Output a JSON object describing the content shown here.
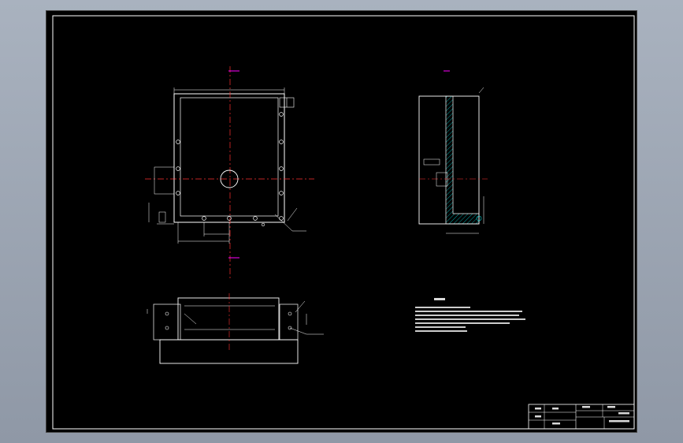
{
  "drawing": {
    "background": "#000000",
    "line_color": "#ffffff",
    "centerline_color": "#ff0000",
    "section_mark_color": "#ff00ff",
    "hatch_color": "#00c8c8"
  },
  "title_block": {
    "cell_a": "",
    "cell_b": "",
    "cell_c": "",
    "cell_d": ""
  }
}
